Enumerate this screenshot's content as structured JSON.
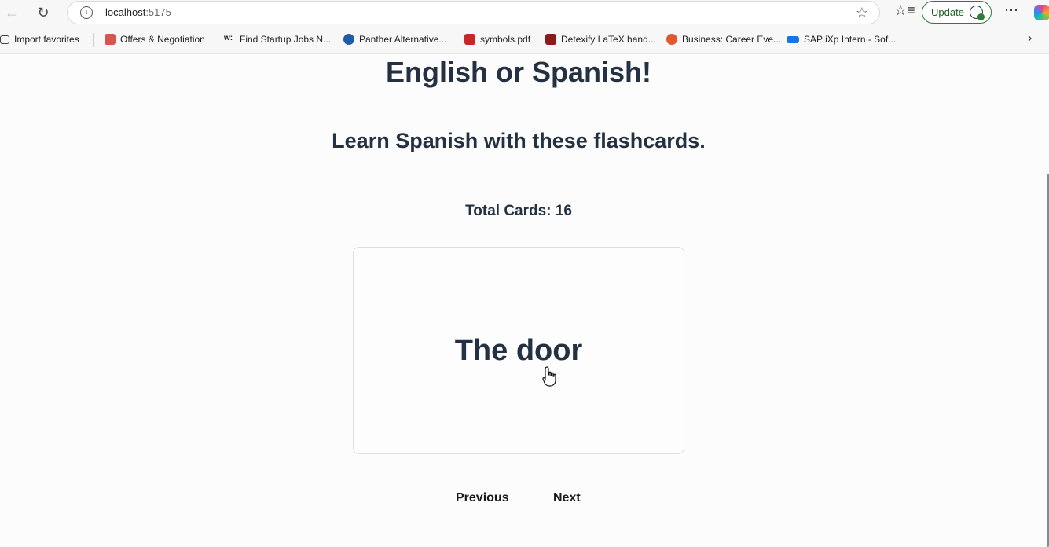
{
  "browser": {
    "url_host": "localhost",
    "url_port": ":5175",
    "update_label": "Update",
    "icons": [
      "back-icon",
      "refresh-icon",
      "info-icon",
      "star-icon",
      "favorites-icon",
      "more-icon",
      "copilot-icon"
    ]
  },
  "bookmarks": [
    {
      "label": "Import favorites",
      "color": "#444444"
    },
    {
      "label": "Offers & Negotiation",
      "color": "#d9534f"
    },
    {
      "label": "Find Startup Jobs N...",
      "color": "#222222"
    },
    {
      "label": "Panther Alternative...",
      "color": "#1e5aa8"
    },
    {
      "label": "symbols.pdf",
      "color": "#c62828"
    },
    {
      "label": "Detexify LaTeX hand...",
      "color": "#8b1a1a"
    },
    {
      "label": "Business: Career Eve...",
      "color": "#e4572e"
    },
    {
      "label": "SAP iXp Intern - Sof...",
      "color": "#1a73e8"
    }
  ],
  "app": {
    "title": "English or Spanish!",
    "subtitle": "Learn Spanish with these flashcards.",
    "total_cards": "Total Cards: 16",
    "card_text": "The door",
    "prev_label": "Previous",
    "next_label": "Next"
  },
  "colors": {
    "heading": "#233142",
    "update_border": "#2e7d32"
  }
}
